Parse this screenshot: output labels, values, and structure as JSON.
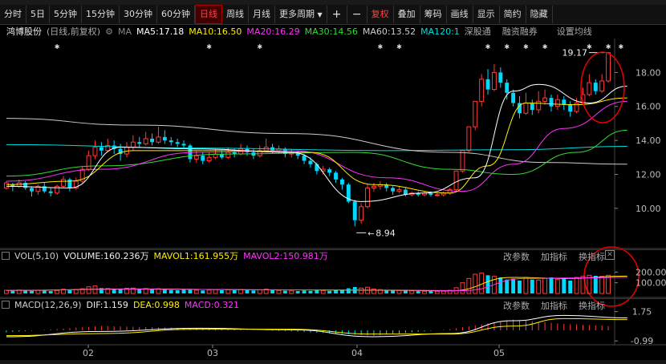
{
  "toolbar": {
    "items": [
      "分时",
      "5日",
      "5分钟",
      "15分钟",
      "30分钟",
      "60分钟",
      "日线",
      "周线",
      "月线",
      "更多周期",
      "+",
      "−",
      "复权",
      "叠加",
      "筹码",
      "画线",
      "显示",
      "简约",
      "隐藏"
    ],
    "active": "日线",
    "more_period_arrow": "▼",
    "plus": "+",
    "minus": "−"
  },
  "info": {
    "stock": "鸿博股份",
    "mode": "(日线,前复权)",
    "ma_label": "MA",
    "ma5": "MA5:17.18",
    "ma10": "MA10:16.50",
    "ma20": "MA20:16.29",
    "ma30": "MA30:14.56",
    "ma60": "MA60:13.52",
    "ma120": "MA120:1",
    "links": [
      "深股通",
      "融资融券"
    ],
    "settings": "设置均线"
  },
  "colors": {
    "up": "#ff3b3b",
    "down": "#00d8ff",
    "ma5": "#ffffff",
    "ma10": "#ffee00",
    "ma20": "#ff33ff",
    "ma30": "#33dd33",
    "ma60": "#cccccc",
    "ma120": "#00dddd",
    "circle": "#e00000"
  },
  "chart_data": [
    {
      "type": "candlestick",
      "title": "鸿博股份",
      "ylim": [
        8.2,
        20
      ],
      "y_ticks": [
        "18.00",
        "16.00",
        "14.00",
        "12.00",
        "10.00"
      ],
      "x_ticks": [
        "02",
        "03",
        "04",
        "05"
      ],
      "annotations": {
        "high": "19.17",
        "low": "8.94"
      },
      "candles": [
        [
          11.2,
          11.5,
          11.6,
          11.1
        ],
        [
          11.4,
          11.3,
          11.5,
          11.0
        ],
        [
          11.3,
          11.5,
          11.7,
          11.2
        ],
        [
          11.5,
          11.2,
          11.6,
          11.1
        ],
        [
          11.2,
          11.0,
          11.3,
          10.7
        ],
        [
          11.0,
          11.3,
          11.4,
          10.8
        ],
        [
          11.3,
          11.0,
          11.5,
          10.9
        ],
        [
          11.0,
          10.9,
          11.2,
          10.7
        ],
        [
          10.9,
          11.3,
          11.4,
          10.8
        ],
        [
          11.3,
          11.7,
          11.9,
          11.2
        ],
        [
          11.7,
          11.2,
          11.8,
          11.0
        ],
        [
          11.2,
          11.6,
          11.8,
          11.1
        ],
        [
          11.6,
          12.3,
          12.5,
          11.5
        ],
        [
          12.3,
          13.1,
          13.4,
          12.2
        ],
        [
          13.1,
          13.6,
          14.0,
          12.9
        ],
        [
          13.6,
          13.4,
          13.9,
          13.1
        ],
        [
          13.4,
          13.7,
          14.1,
          13.3
        ],
        [
          13.7,
          13.5,
          14.0,
          13.2
        ],
        [
          13.5,
          13.2,
          13.8,
          12.8
        ],
        [
          13.2,
          13.6,
          13.9,
          13.0
        ],
        [
          13.6,
          13.9,
          14.3,
          13.4
        ],
        [
          13.9,
          13.8,
          14.2,
          13.6
        ],
        [
          13.8,
          14.1,
          14.5,
          13.7
        ],
        [
          14.1,
          13.9,
          14.4,
          13.7
        ],
        [
          13.9,
          14.2,
          14.8,
          13.8
        ],
        [
          14.2,
          14.0,
          14.6,
          13.8
        ],
        [
          14.0,
          13.9,
          14.2,
          13.7
        ],
        [
          13.9,
          13.8,
          14.1,
          13.6
        ],
        [
          13.8,
          13.7,
          14.0,
          13.5
        ],
        [
          13.7,
          12.9,
          13.8,
          12.7
        ],
        [
          12.9,
          13.1,
          13.4,
          12.7
        ],
        [
          13.1,
          12.8,
          13.3,
          12.6
        ],
        [
          12.8,
          13.0,
          13.3,
          12.7
        ],
        [
          13.0,
          13.2,
          13.5,
          12.9
        ],
        [
          13.2,
          13.0,
          13.4,
          12.9
        ],
        [
          13.0,
          13.3,
          13.6,
          12.9
        ],
        [
          13.3,
          13.2,
          13.5,
          13.0
        ],
        [
          13.2,
          13.5,
          13.8,
          13.1
        ],
        [
          13.5,
          13.3,
          13.7,
          13.1
        ],
        [
          13.3,
          13.1,
          13.5,
          12.9
        ],
        [
          13.1,
          13.4,
          13.7,
          13.0
        ],
        [
          13.4,
          13.6,
          14.1,
          13.3
        ],
        [
          13.6,
          13.4,
          13.8,
          13.2
        ],
        [
          13.4,
          13.5,
          13.7,
          13.2
        ],
        [
          13.5,
          13.2,
          13.6,
          13.0
        ],
        [
          13.2,
          13.3,
          13.5,
          13.0
        ],
        [
          13.3,
          13.1,
          13.4,
          12.9
        ],
        [
          13.1,
          12.8,
          13.2,
          12.6
        ],
        [
          12.8,
          12.6,
          13.0,
          12.4
        ],
        [
          12.6,
          12.2,
          12.7,
          12.0
        ],
        [
          12.2,
          12.3,
          12.5,
          12.0
        ],
        [
          12.3,
          12.1,
          12.4,
          11.9
        ],
        [
          12.1,
          11.7,
          12.2,
          11.5
        ],
        [
          11.7,
          11.4,
          11.8,
          11.1
        ],
        [
          11.4,
          10.4,
          11.5,
          10.3
        ],
        [
          10.4,
          9.3,
          10.5,
          8.94
        ],
        [
          9.3,
          10.1,
          10.3,
          9.1
        ],
        [
          10.1,
          11.2,
          11.4,
          10.0
        ],
        [
          11.2,
          11.3,
          11.5,
          11.0
        ],
        [
          11.3,
          11.4,
          11.6,
          11.1
        ],
        [
          11.4,
          11.2,
          11.5,
          11.0
        ],
        [
          11.2,
          11.0,
          11.3,
          10.8
        ],
        [
          11.0,
          11.1,
          11.3,
          10.9
        ],
        [
          11.1,
          10.8,
          11.2,
          10.7
        ],
        [
          10.8,
          10.9,
          11.0,
          10.7
        ],
        [
          10.9,
          10.8,
          11.0,
          10.7
        ],
        [
          10.8,
          10.9,
          11.0,
          10.7
        ],
        [
          10.9,
          10.8,
          11.0,
          10.7
        ],
        [
          10.8,
          10.8,
          10.9,
          10.7
        ],
        [
          10.8,
          10.9,
          11.0,
          10.7
        ],
        [
          10.9,
          11.1,
          11.2,
          10.8
        ],
        [
          11.1,
          12.2,
          12.2,
          11.0
        ],
        [
          12.2,
          13.4,
          13.4,
          12.1
        ],
        [
          13.4,
          14.8,
          14.8,
          13.3
        ],
        [
          14.8,
          16.3,
          16.3,
          14.6
        ],
        [
          16.3,
          17.6,
          17.9,
          16.0
        ],
        [
          17.6,
          17.0,
          18.2,
          16.7
        ],
        [
          17.0,
          18.0,
          18.5,
          16.9
        ],
        [
          18.0,
          17.4,
          18.3,
          17.1
        ],
        [
          17.4,
          16.8,
          17.6,
          16.4
        ],
        [
          16.8,
          16.2,
          17.0,
          16.0
        ],
        [
          16.2,
          15.6,
          16.6,
          15.3
        ],
        [
          15.6,
          16.2,
          16.8,
          15.5
        ],
        [
          16.2,
          15.8,
          16.4,
          15.5
        ],
        [
          15.8,
          16.3,
          16.9,
          15.6
        ],
        [
          16.3,
          16.5,
          17.0,
          16.1
        ],
        [
          16.5,
          16.0,
          16.7,
          15.7
        ],
        [
          16.0,
          16.4,
          16.7,
          15.8
        ],
        [
          16.4,
          16.1,
          16.6,
          15.8
        ],
        [
          16.1,
          15.7,
          16.3,
          15.4
        ],
        [
          15.7,
          16.2,
          16.5,
          15.6
        ],
        [
          16.2,
          16.7,
          17.1,
          16.1
        ],
        [
          16.7,
          17.4,
          17.9,
          16.6
        ],
        [
          17.4,
          16.9,
          17.6,
          16.7
        ],
        [
          16.9,
          17.5,
          17.9,
          16.8
        ],
        [
          17.5,
          19.17,
          19.17,
          17.4
        ]
      ],
      "ma": {
        "ma120": [
          [
            0,
            13.75
          ],
          [
            30,
            13.55
          ],
          [
            60,
            13.4
          ],
          [
            80,
            13.45
          ],
          [
            98,
            13.65
          ]
        ],
        "ma60": [
          [
            0,
            15.3
          ],
          [
            20,
            14.9
          ],
          [
            45,
            14.4
          ],
          [
            70,
            13.3
          ],
          [
            85,
            12.7
          ],
          [
            98,
            12.6
          ]
        ],
        "ma30": [
          [
            0,
            11.9
          ],
          [
            15,
            12.5
          ],
          [
            35,
            13.2
          ],
          [
            55,
            13.3
          ],
          [
            70,
            12.3
          ],
          [
            80,
            12.0
          ],
          [
            90,
            13.3
          ],
          [
            98,
            14.6
          ]
        ],
        "ma20": [
          [
            0,
            11.6
          ],
          [
            15,
            12.3
          ],
          [
            30,
            13.3
          ],
          [
            45,
            13.4
          ],
          [
            60,
            11.8
          ],
          [
            72,
            11.0
          ],
          [
            80,
            12.6
          ],
          [
            88,
            14.7
          ],
          [
            98,
            16.3
          ]
        ],
        "ma10": [
          [
            0,
            11.4
          ],
          [
            10,
            11.6
          ],
          [
            20,
            13.4
          ],
          [
            35,
            13.4
          ],
          [
            48,
            13.3
          ],
          [
            58,
            11.4
          ],
          [
            70,
            10.9
          ],
          [
            76,
            12.5
          ],
          [
            82,
            16.2
          ],
          [
            90,
            16.1
          ],
          [
            98,
            16.5
          ]
        ],
        "ma5": [
          [
            0,
            11.3
          ],
          [
            10,
            11.2
          ],
          [
            18,
            13.6
          ],
          [
            30,
            13.5
          ],
          [
            45,
            13.3
          ],
          [
            56,
            10.4
          ],
          [
            66,
            10.9
          ],
          [
            74,
            11.8
          ],
          [
            80,
            16.9
          ],
          [
            84,
            17.3
          ],
          [
            92,
            16.2
          ],
          [
            98,
            17.2
          ]
        ]
      }
    },
    {
      "type": "bar",
      "title": "VOL(5,10)",
      "ylim": [
        0,
        300
      ],
      "y_ticks": [
        "200.00",
        "100.00"
      ],
      "volume_label": "VOLUME:160.236万",
      "mavol1": "MAVOL1:161.955万",
      "mavol2": "MAVOL2:150.981万",
      "links": [
        "改参数",
        "加指标",
        "换指标"
      ],
      "values": [
        30,
        25,
        32,
        28,
        24,
        30,
        26,
        22,
        28,
        40,
        30,
        36,
        44,
        62,
        70,
        50,
        46,
        44,
        42,
        48,
        50,
        40,
        46,
        38,
        44,
        36,
        32,
        30,
        34,
        40,
        30,
        28,
        32,
        36,
        30,
        34,
        30,
        36,
        32,
        28,
        34,
        40,
        30,
        28,
        26,
        24,
        22,
        28,
        24,
        30,
        28,
        24,
        32,
        34,
        48,
        60,
        50,
        58,
        42,
        36,
        34,
        30,
        28,
        26,
        24,
        22,
        20,
        22,
        20,
        22,
        30,
        54,
        100,
        140,
        180,
        190,
        170,
        160,
        150,
        130,
        140,
        120,
        150,
        130,
        125,
        140,
        150,
        130,
        140,
        120,
        150,
        160,
        170,
        165,
        160,
        170
      ]
    },
    {
      "type": "line",
      "title": "MACD(12,26,9)",
      "ylim": [
        -1.2,
        2.1
      ],
      "y_ticks": [
        "1.75",
        "-0.99"
      ],
      "dif": "DIF:1.159",
      "dea": "DEA:0.998",
      "macd": "MACD:0.321",
      "links": [
        "改参数",
        "加指标",
        "换指标"
      ],
      "dif_series": [
        [
          0,
          -0.6
        ],
        [
          15,
          -0.1
        ],
        [
          30,
          0.2
        ],
        [
          45,
          0.05
        ],
        [
          58,
          -0.6
        ],
        [
          70,
          -0.3
        ],
        [
          80,
          0.9
        ],
        [
          88,
          1.4
        ],
        [
          98,
          1.16
        ]
      ],
      "dea_series": [
        [
          0,
          -0.5
        ],
        [
          15,
          -0.3
        ],
        [
          30,
          0.1
        ],
        [
          45,
          0.1
        ],
        [
          58,
          -0.35
        ],
        [
          70,
          -0.35
        ],
        [
          80,
          0.4
        ],
        [
          88,
          1.1
        ],
        [
          98,
          1.0
        ]
      ]
    }
  ]
}
